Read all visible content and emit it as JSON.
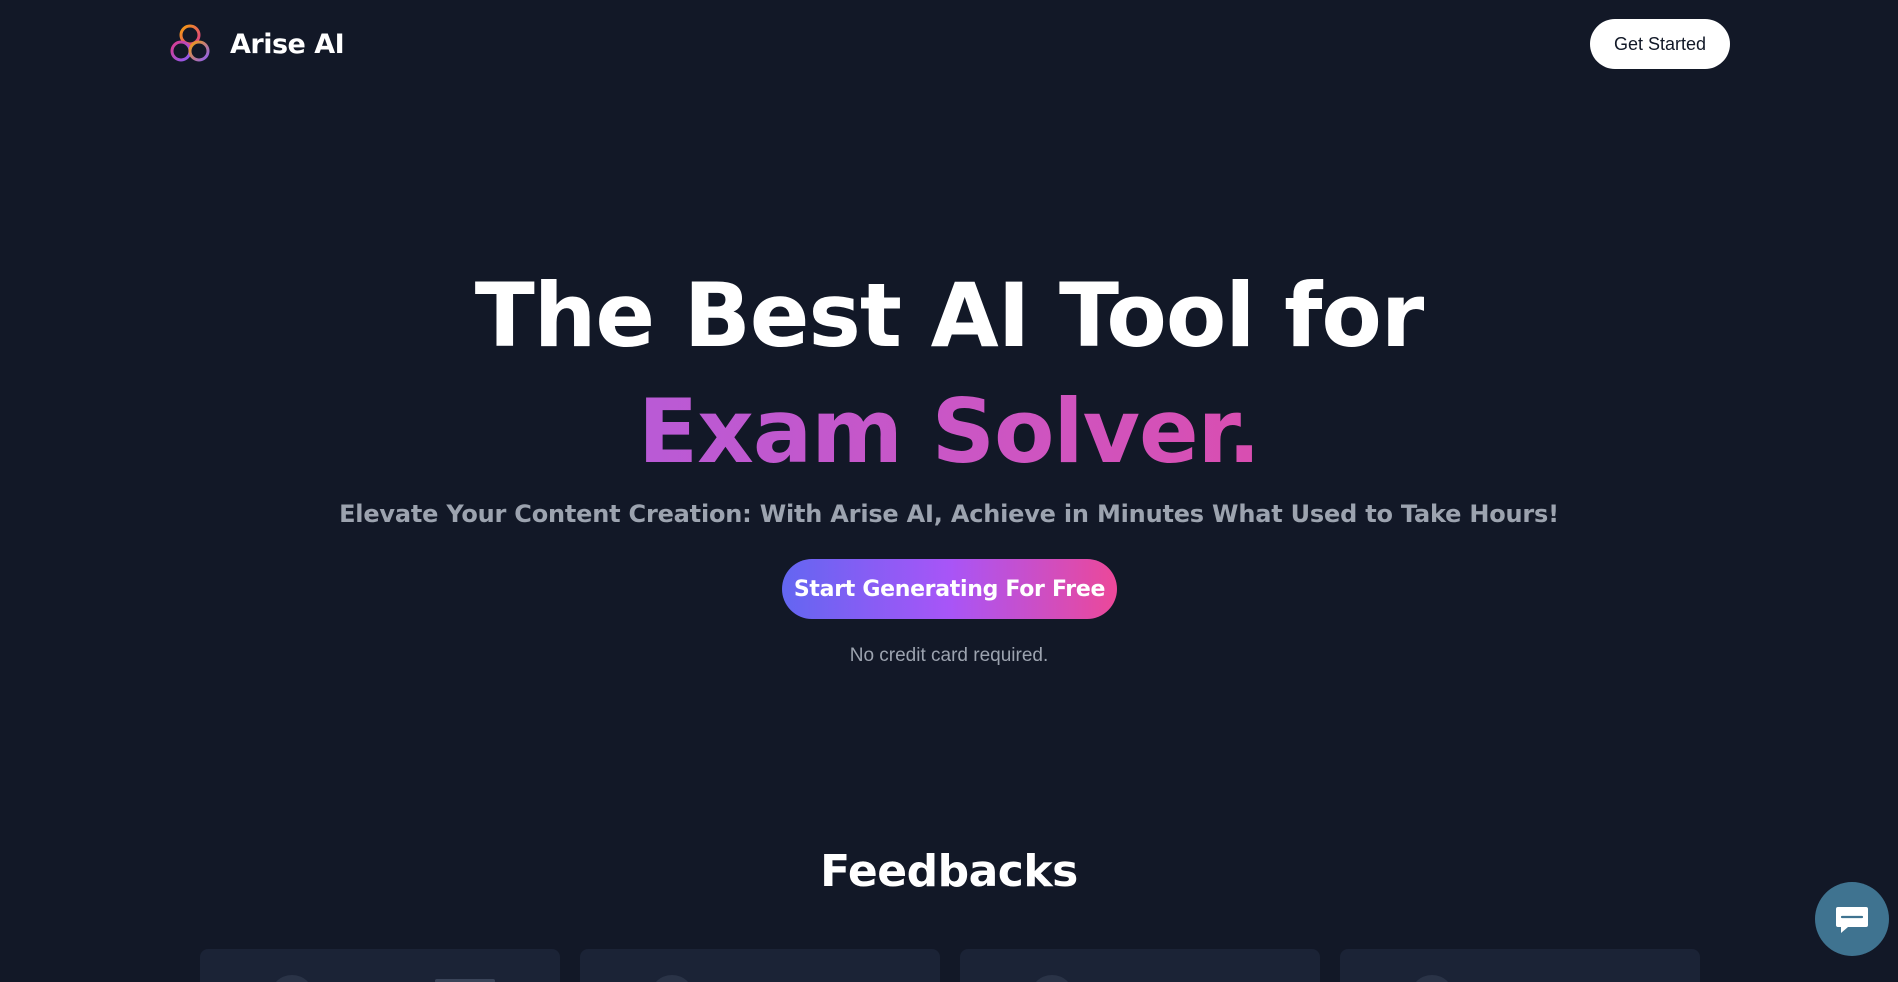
{
  "brand": {
    "name": "Arise AI",
    "logo_icon": "interlocking-rings-logo",
    "colors": {
      "ring_pink": "#db3a8c",
      "ring_orange": "#f59e0b",
      "ring_purple": "#8b5cf6"
    }
  },
  "header": {
    "cta_label": "Get Started"
  },
  "hero": {
    "title_line1": "The Best AI Tool for",
    "title_line2": "Exam Solver.",
    "subtitle": "Elevate Your Content Creation: With Arise AI, Achieve in Minutes What Used to Take Hours!",
    "cta_label": "Start Generating For Free",
    "note": "No credit card required."
  },
  "feedbacks": {
    "title": "Feedbacks",
    "card_count_visible": 4
  },
  "chat_widget": {
    "icon": "chat-bubble-icon",
    "color": "#3f7390"
  },
  "theme": {
    "background": "#121827",
    "muted_text": "#9ca3af",
    "cta_gradient": [
      "#6366f1",
      "#a855f7",
      "#ec4899"
    ],
    "accent_gradient": [
      "#b95ad6",
      "#d94eb0"
    ]
  }
}
